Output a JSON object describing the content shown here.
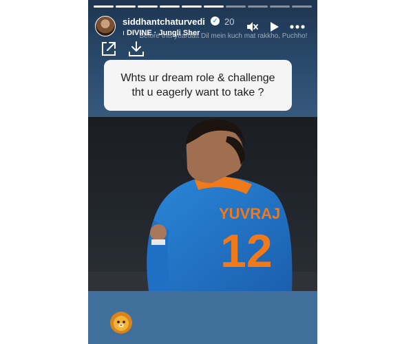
{
  "story": {
    "username": "siddhantchaturvedi",
    "time_ago": "20",
    "music": "DIVINE · Jungli Sher",
    "prompt_text": "Before this yeardatt Dil mein kuch mat rakkho, Puchho!",
    "question": "Whts ur dream role & challenge tht u eagerly want to take ?",
    "progress_segments": 10,
    "active_segment": 6
  },
  "photo": {
    "jersey_name": "YUVRAJ",
    "jersey_number": "12"
  },
  "icons": {
    "verified": "verified-badge-icon",
    "mute": "speaker-muted-icon",
    "play": "play-icon",
    "more": "more-options-icon",
    "share": "external-link-icon",
    "download": "download-icon",
    "sticker": "lion-emoji-icon"
  },
  "colors": {
    "story_bg": "#3f6f9a",
    "card_bg": "#f5f5f5",
    "jersey_blue": "#1f6fc4",
    "jersey_orange": "#f07a1a"
  }
}
